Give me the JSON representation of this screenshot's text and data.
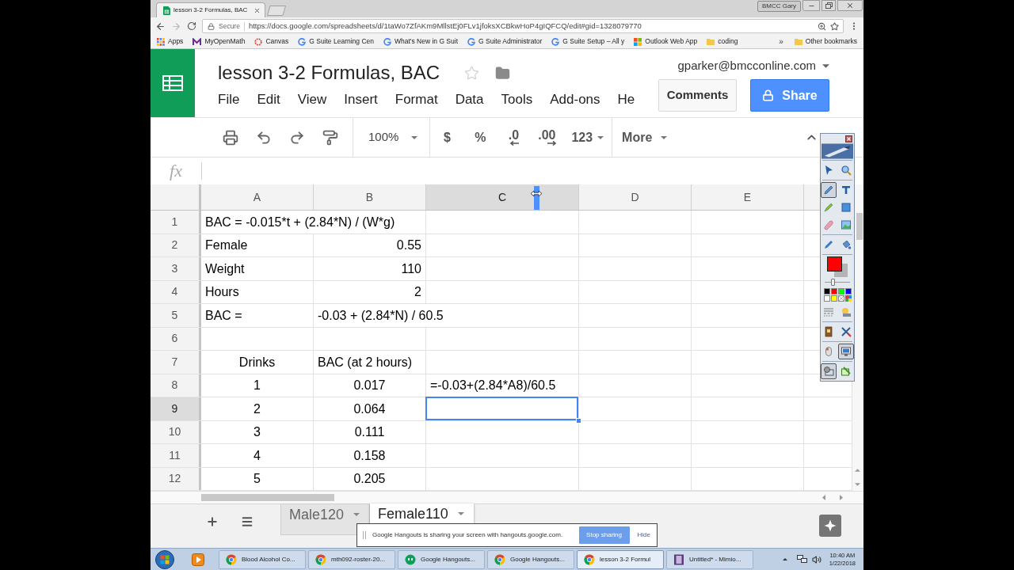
{
  "browser": {
    "tabs": [
      {
        "title": "lesson 3-2 Formulas, BAC",
        "selected": true
      }
    ],
    "profile": "BMCC Gary",
    "address": {
      "security": "Secure",
      "url": "https://docs.google.com/spreadsheets/d/1taWo7ZfAKm9MllstEj0FLv1jfoksXCBkwHoP4gIQFCQ/edit#gid=1328079770"
    },
    "bookmarks": [
      {
        "kind": "apps",
        "label": "Apps"
      },
      {
        "kind": "letter",
        "label": "MyOpenMath"
      },
      {
        "kind": "ring",
        "label": "Canvas"
      },
      {
        "kind": "google",
        "label": "G Suite Learning Cen"
      },
      {
        "kind": "google",
        "label": "What's New in G Suit"
      },
      {
        "kind": "google",
        "label": "G Suite Administrator"
      },
      {
        "kind": "google",
        "label": "G Suite Setup – All y"
      },
      {
        "kind": "windows",
        "label": "Outlook Web App"
      },
      {
        "kind": "folder",
        "label": "coding"
      }
    ],
    "bookmarks_overflow": "»",
    "other_bookmarks": "Other bookmarks"
  },
  "sheets": {
    "title": "lesson 3-2 Formulas, BAC",
    "starred": false,
    "menu": [
      "File",
      "Edit",
      "View",
      "Insert",
      "Format",
      "Data",
      "Tools",
      "Add-ons",
      "He"
    ],
    "account": "gparker@bmcconline.com",
    "comments": "Comments",
    "share": "Share"
  },
  "toolbar": {
    "zoom": "100%",
    "format_buttons": [
      {
        "kind": "plain",
        "label": "$"
      },
      {
        "kind": "plain",
        "label": "%"
      },
      {
        "kind": "decrease",
        "label": ".0"
      },
      {
        "kind": "increase",
        "label": ".00"
      },
      {
        "kind": "dropdown",
        "label": "123"
      }
    ],
    "more": "More"
  },
  "formula_bar": {
    "label": "fx"
  },
  "grid": {
    "columns": [
      {
        "label": "A",
        "selected": false
      },
      {
        "label": "B",
        "selected": false
      },
      {
        "label": "C",
        "selected": true
      },
      {
        "label": "D",
        "selected": false
      },
      {
        "label": "E",
        "selected": false
      }
    ],
    "rows": [
      {
        "number": "1",
        "selected": false,
        "cells": [
          {
            "text": "BAC = -0.015*t + (2.84*N) / (W*g)",
            "kind": "label",
            "selected": false
          },
          {
            "selected": false
          },
          {
            "selected": false
          },
          {
            "selected": false
          },
          {
            "selected": false
          }
        ]
      },
      {
        "number": "2",
        "selected": false,
        "cells": [
          {
            "text": "Female",
            "kind": "label",
            "selected": false
          },
          {
            "text": "0.55",
            "kind": "number",
            "selected": false
          },
          {
            "selected": false
          },
          {
            "selected": false
          },
          {
            "selected": false
          }
        ]
      },
      {
        "number": "3",
        "selected": false,
        "cells": [
          {
            "text": "Weight",
            "kind": "label",
            "selected": false
          },
          {
            "text": "110",
            "kind": "number",
            "selected": false
          },
          {
            "selected": false
          },
          {
            "selected": false
          },
          {
            "selected": false
          }
        ]
      },
      {
        "number": "4",
        "selected": false,
        "cells": [
          {
            "text": "Hours",
            "kind": "label",
            "selected": false
          },
          {
            "text": "2",
            "kind": "number",
            "selected": false
          },
          {
            "selected": false
          },
          {
            "selected": false
          },
          {
            "selected": false
          }
        ]
      },
      {
        "number": "5",
        "selected": false,
        "cells": [
          {
            "text": "BAC =",
            "kind": "label",
            "selected": false
          },
          {
            "text": "-0.03 + (2.84*N) / 60.5",
            "kind": "label",
            "selected": false
          },
          {
            "selected": false
          },
          {
            "selected": false
          },
          {
            "selected": false
          }
        ]
      },
      {
        "number": "6",
        "selected": false,
        "cells": [
          {
            "selected": false
          },
          {
            "selected": false
          },
          {
            "selected": false
          },
          {
            "selected": false
          },
          {
            "selected": false
          }
        ]
      },
      {
        "number": "7",
        "selected": false,
        "cells": [
          {
            "text": "Drinks",
            "kind": "centered",
            "selected": false
          },
          {
            "text": "BAC (at 2 hours)",
            "kind": "label",
            "selected": false
          },
          {
            "selected": false
          },
          {
            "selected": false
          },
          {
            "selected": false
          }
        ]
      },
      {
        "number": "8",
        "selected": false,
        "cells": [
          {
            "text": "1",
            "kind": "centered",
            "selected": false
          },
          {
            "text": "0.017",
            "kind": "centered",
            "selected": false
          },
          {
            "text": "=-0.03+(2.84*A8)/60.5",
            "kind": "label",
            "selected": false
          },
          {
            "selected": false
          },
          {
            "selected": false
          }
        ]
      },
      {
        "number": "9",
        "selected": true,
        "cells": [
          {
            "text": "2",
            "kind": "centered",
            "selected": false
          },
          {
            "text": "0.064",
            "kind": "centered",
            "selected": false
          },
          {
            "selected": true
          },
          {
            "selected": false
          },
          {
            "selected": false
          }
        ]
      },
      {
        "number": "10",
        "selected": false,
        "cells": [
          {
            "text": "3",
            "kind": "centered",
            "selected": false
          },
          {
            "text": "0.111",
            "kind": "centered",
            "selected": false
          },
          {
            "selected": false
          },
          {
            "selected": false
          },
          {
            "selected": false
          }
        ]
      },
      {
        "number": "11",
        "selected": false,
        "cells": [
          {
            "text": "4",
            "kind": "centered",
            "selected": false
          },
          {
            "text": "0.158",
            "kind": "centered",
            "selected": false
          },
          {
            "selected": false
          },
          {
            "selected": false
          },
          {
            "selected": false
          }
        ]
      },
      {
        "number": "12",
        "selected": false,
        "cells": [
          {
            "text": "5",
            "kind": "centered",
            "selected": false
          },
          {
            "text": "0.205",
            "kind": "centered",
            "selected": false
          },
          {
            "selected": false
          },
          {
            "selected": false
          },
          {
            "selected": false
          }
        ]
      }
    ]
  },
  "sheet_tabs": [
    {
      "label": "Male120",
      "selected": false
    },
    {
      "label": "Female110",
      "selected": true
    }
  ],
  "screen_share": {
    "message": "Google Hangouts is sharing your screen with hangouts.google.com.",
    "stop": "Stop sharing",
    "hide": "Hide"
  },
  "annotation_palette": {
    "tools": [
      {
        "kind": "pointer",
        "selected": false
      },
      {
        "kind": "zoom",
        "selected": false
      },
      {
        "kind": "pen",
        "selected": true
      },
      {
        "kind": "text",
        "selected": false
      },
      {
        "kind": "highlighter",
        "selected": false
      },
      {
        "kind": "shape",
        "selected": false
      },
      {
        "kind": "eraser",
        "selected": false
      },
      {
        "kind": "image",
        "selected": false
      },
      {
        "kind": "pen_alt",
        "selected": false
      },
      {
        "kind": "fill",
        "selected": false
      }
    ],
    "colors": [
      {
        "kind": "background",
        "color": "#b4b4b4"
      },
      {
        "kind": "foreground",
        "color": "#ff0000"
      }
    ],
    "thickness": {
      "level": 0.3
    },
    "swatches": [
      {
        "kind": "solid",
        "color": "#000000"
      },
      {
        "kind": "solid",
        "color": "#ff0000"
      },
      {
        "kind": "solid",
        "color": "#00ff00"
      },
      {
        "kind": "solid",
        "color": "#0000ff"
      },
      {
        "kind": "solid",
        "color": "#ffffff"
      },
      {
        "kind": "solid",
        "color": "#ffff00"
      },
      {
        "kind": "none"
      },
      {
        "kind": "multi"
      }
    ],
    "extras": [
      {
        "kind": "lines",
        "selected": false
      },
      {
        "kind": "gallery",
        "selected": false
      },
      {
        "kind": "book",
        "selected": false
      },
      {
        "kind": "clear",
        "selected": false
      },
      {
        "kind": "mouse",
        "selected": false
      },
      {
        "kind": "screen",
        "selected": true
      },
      {
        "kind": "capture",
        "selected": true
      },
      {
        "kind": "insert",
        "selected": false
      }
    ]
  },
  "taskbar": {
    "tasks": [
      {
        "kind": "chrome",
        "label": "Blood Alcohol Co...",
        "selected": false
      },
      {
        "kind": "chrome",
        "label": "mth092-roster-20...",
        "selected": false
      },
      {
        "kind": "hangouts",
        "label": "Google Hangouts...",
        "selected": false
      },
      {
        "kind": "chrome",
        "label": "Google Hangouts...",
        "selected": false
      },
      {
        "kind": "chrome",
        "label": "lesson 3-2 Formul",
        "selected": true
      },
      {
        "kind": "mimio",
        "label": "Untitled* - Mimio...",
        "selected": false
      }
    ],
    "time": "10:40 AM",
    "date": "1/22/2018"
  }
}
